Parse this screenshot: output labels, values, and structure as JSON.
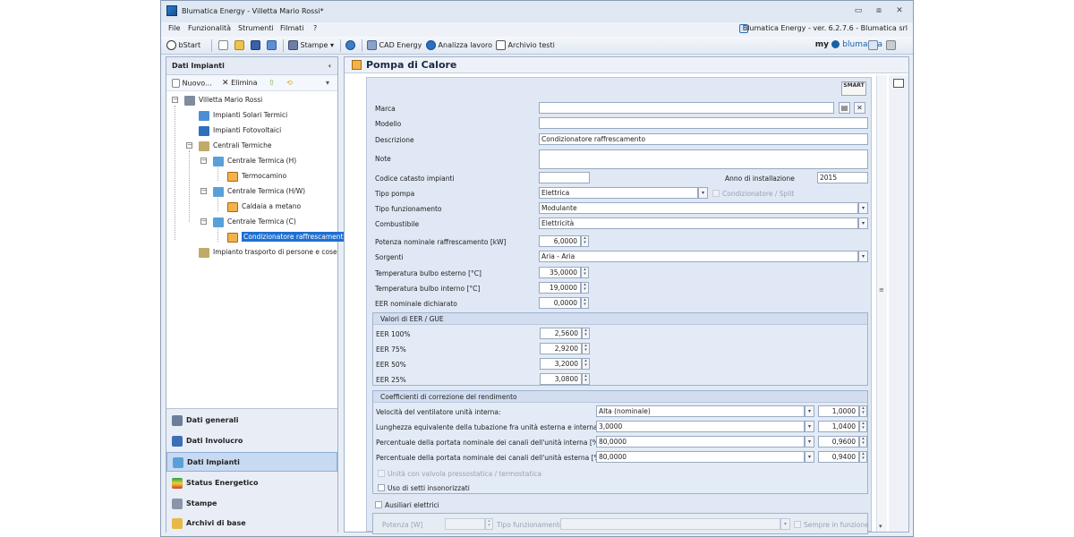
{
  "window": {
    "title": "Blumatica Energy - Villetta Mario Rossi*",
    "minimize": "▭",
    "restore": "⧈",
    "close": "✕"
  },
  "menu": {
    "items": [
      "File",
      "Funzionalità",
      "Strumenti",
      "Filmati",
      "?"
    ],
    "version": "Blumatica Energy - ver. 6.2.7.6 - Blumatica srl"
  },
  "toolbar": {
    "bstart": "bStart",
    "stampe": "Stampe",
    "cad": "CAD Energy",
    "analizza": "Analizza lavoro",
    "archivio": "Archivio testi",
    "brand_my": "my",
    "brand_name": "blumatica"
  },
  "left": {
    "title": "Dati Impianti",
    "collapse": "‹",
    "nuovo": "Nuovo...",
    "elimina": "Elimina",
    "tree": {
      "root": "Villetta Mario Rossi",
      "solari": "Impianti Solari Termici",
      "fotovoltaici": "Impianti Fotovoltaici",
      "centrali": "Centrali Termiche",
      "ct_h": "Centrale Termica (H)",
      "termocamino": "Termocamino",
      "ct_hw": "Centrale Termica (H/W)",
      "caldaia": "Caldaia a metano",
      "ct_c": "Centrale Termica (C)",
      "condizionatore": "Condizionatore raffrescamento",
      "trasporto": "Impianto trasporto di persone e cose"
    },
    "nav": {
      "generali": "Dati generali",
      "involucro": "Dati Involucro",
      "impianti": "Dati Impianti",
      "status": "Status Energetico",
      "stampe": "Stampe",
      "archivi": "Archivi di base"
    }
  },
  "main": {
    "title": "Pompa di Calore",
    "smart": "SMART",
    "labels": {
      "marca": "Marca",
      "modello": "Modello",
      "descrizione": "Descrizione",
      "note": "Note",
      "codice": "Codice catasto impianti",
      "anno": "Anno di installazione",
      "tipo_pompa": "Tipo pompa",
      "condizionatore_split": "Condizionatore / Split",
      "tipo_funz": "Tipo funzionamento",
      "combustibile": "Combustibile",
      "potenza": "Potenza nominale raffrescamento [kW]",
      "sorgenti": "Sorgenti",
      "t_esterno": "Temperatura bulbo esterno [°C]",
      "t_interno": "Temperatura bulbo interno [°C]",
      "eer_nom": "EER nominale dichiarato"
    },
    "values": {
      "marca": "",
      "modello": "",
      "descrizione": "Condizionatore raffrescamento",
      "note": "",
      "codice": "",
      "anno": "2015",
      "tipo_pompa": "Elettrica",
      "tipo_funz": "Modulante",
      "combustibile": "Elettricità",
      "potenza": "6,0000",
      "sorgenti": "Aria - Aria",
      "t_esterno": "35,0000",
      "t_interno": "19,0000",
      "eer_nom": "0,0000"
    },
    "eer_group": {
      "title": "Valori di EER / GUE",
      "rows": [
        {
          "label": "EER 100%",
          "value": "2,5600"
        },
        {
          "label": "EER 75%",
          "value": "2,9200"
        },
        {
          "label": "EER 50%",
          "value": "3,2000"
        },
        {
          "label": "EER 25%",
          "value": "3,0800"
        }
      ]
    },
    "coeff_group": {
      "title": "Coefficienti di correzione del rendimento",
      "rows": [
        {
          "label": "Velocità del ventilatore unità interna:",
          "select": "Alta (nominale)",
          "coeff": "1,0000"
        },
        {
          "label": "Lunghezza equivalente della tubazione fra unità esterna e interna [m]:",
          "select": "3,0000",
          "coeff": "1,0400"
        },
        {
          "label": "Percentuale della portata nominale dei canali dell'unità interna [%]:",
          "select": "80,0000",
          "coeff": "0,9600"
        },
        {
          "label": "Percentuale della portata nominale dei canali dell'unità esterna [%]:",
          "select": "80,0000",
          "coeff": "0,9400"
        }
      ],
      "valvola": "Unità con valvola pressostatica / termostatica",
      "setti": "Uso di setti insonorizzati"
    },
    "ausiliari": {
      "label": "Ausiliari elettrici",
      "potenza": "Potenza [W]",
      "tipo_funz": "Tipo funzionamento",
      "sempre": "Sempre in funzione"
    }
  }
}
